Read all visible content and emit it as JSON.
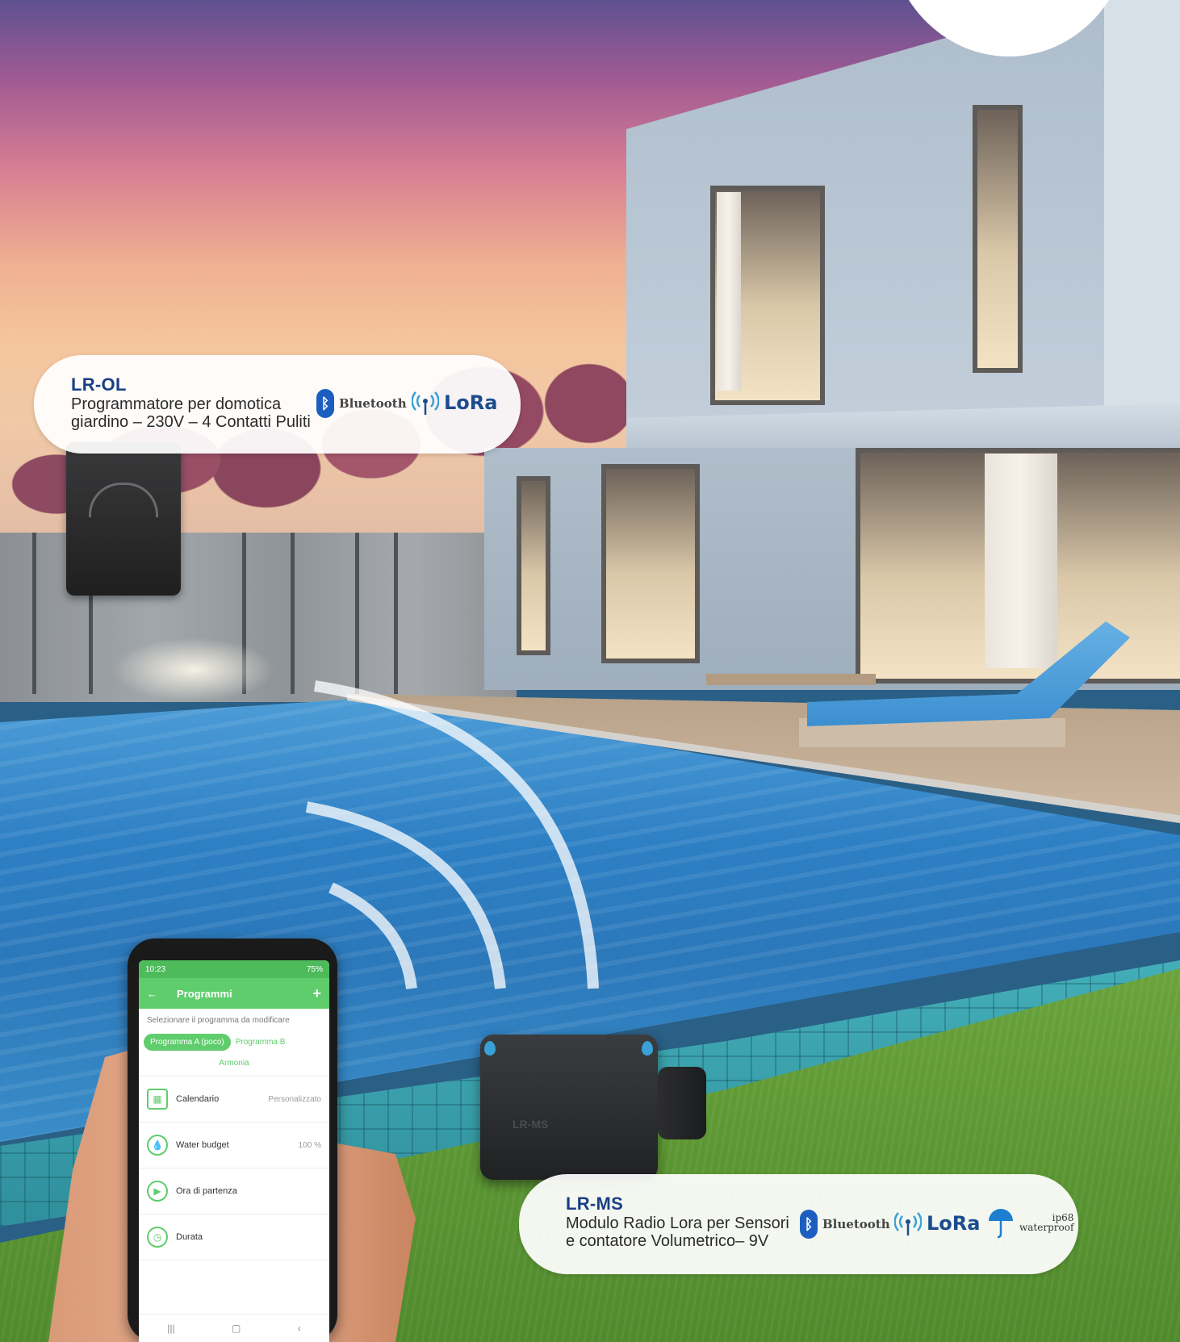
{
  "product_cards": [
    {
      "model": "LR-OL",
      "desc_line1": "Programmatore per domotica",
      "desc_line2": "giardino – 230V – 4 Contatti Puliti",
      "badges": {
        "bluetooth": "Bluetooth",
        "lora": "LoRa"
      }
    },
    {
      "model": "LR-MS",
      "desc_line1": "Modulo Radio Lora per Sensori",
      "desc_line2": "e contatore Volumetrico– 9V",
      "badges": {
        "bluetooth": "Bluetooth",
        "lora": "LoRa",
        "ip_rating": "ip68",
        "waterproof": "waterproof"
      }
    }
  ],
  "devices": {
    "lrms_label": "LR-MS"
  },
  "phone": {
    "status_time": "10:23",
    "status_right": "75%",
    "app_title": "Programmi",
    "back_icon": "←",
    "add_icon": "+",
    "subtitle": "Selezionare il programma da modificare",
    "tabs": [
      "Programma A (poco)",
      "Programma B",
      "Armonia"
    ],
    "rows": [
      {
        "label": "Calendario",
        "value": "Personalizzato",
        "icon": "calendar-icon"
      },
      {
        "label": "Water budget",
        "value": "100 %",
        "icon": "water-drop-icon"
      },
      {
        "label": "Ora di partenza",
        "value": "",
        "icon": "play-icon"
      },
      {
        "label": "Durata",
        "value": "",
        "icon": "clock-icon"
      }
    ],
    "nav": [
      "|||",
      "▢",
      "‹"
    ]
  },
  "colors": {
    "brand_blue": "#1a3f86",
    "app_green": "#5fcd6c",
    "bluetooth_blue": "#1c5ec0"
  }
}
